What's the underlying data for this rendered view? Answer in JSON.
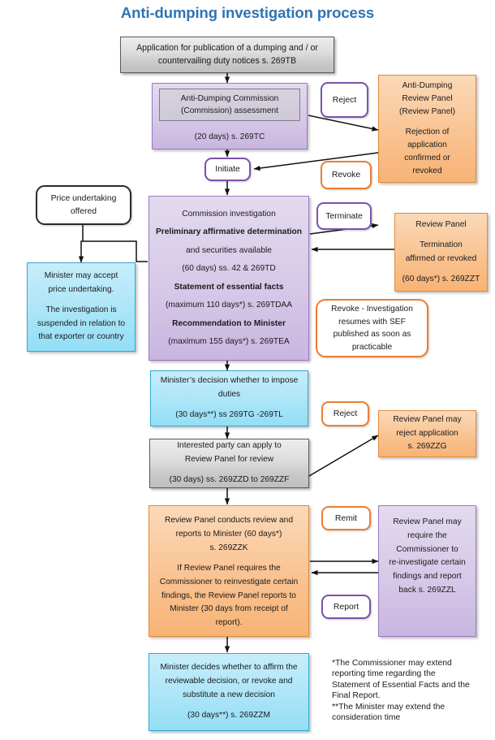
{
  "title": "Anti-dumping investigation process",
  "colors": {
    "title": "#2e74b5",
    "purple_accent": "#7b52ab",
    "orange_accent": "#ed7d31",
    "cyan_fill": "#aee6f8",
    "orange_fill": "#f9c392",
    "purple_fill": "#d6c9e8",
    "grey_fill": "#dcdcdc"
  },
  "nodes": {
    "application": {
      "line1": "Application for publication of a dumping and / or",
      "line2": "countervailing duty notices s. 269TB"
    },
    "commission_assessment": {
      "inner_line1": "Anti-Dumping Commission",
      "inner_line2": "(Commission) assessment",
      "days": "(20 days) s. 269TC"
    },
    "reject_1": {
      "label": "Reject"
    },
    "revoke_1": {
      "label": "Revoke"
    },
    "adrp": {
      "line1": "Anti-Dumping",
      "line2": "Review Panel",
      "line3": "(Review Panel)",
      "line4": "Rejection of",
      "line5": "application",
      "line6": "confirmed or",
      "line7": "revoked"
    },
    "initiate": {
      "label": "Initiate"
    },
    "price_undertaking_offered": {
      "line1": "Price undertaking",
      "line2": "offered"
    },
    "minister_may_accept": {
      "line1": "Minister may accept",
      "line2": "price undertaking.",
      "line3": "The investigation is",
      "line4": "suspended in relation to",
      "line5": "that exporter or country"
    },
    "commission_investigation": {
      "line1": "Commission investigation",
      "line2": "Preliminary affirmative determination",
      "line3": "and securities available",
      "line4": "(60 days) ss. 42 & 269TD",
      "line5": "Statement of essential facts",
      "line6": "(maximum 110 days*) s. 269TDAA",
      "line7": "Recommendation to Minister",
      "line8": "(maximum 155 days*) s. 269TEA"
    },
    "terminate": {
      "label": "Terminate"
    },
    "review_panel_termination": {
      "line1": "Review Panel",
      "line2": "Termination",
      "line3": "affirmed or revoked",
      "line4": "(60 days*) s. 269ZZT"
    },
    "revoke_investigation": {
      "line1": "Revoke - Investigation",
      "line2": "resumes with SEF",
      "line3": "published as soon as",
      "line4": "practicable"
    },
    "minister_decision_duties": {
      "line1": "Minister’s decision whether to impose",
      "line2": "duties",
      "line3": "(30 days**) ss 269TG -269TL"
    },
    "reject_2": {
      "label": "Reject"
    },
    "interested_party": {
      "line1": "Interested party can apply to",
      "line2": "Review Panel for review",
      "line3": "(30 days) ss. 269ZZD to 269ZZF"
    },
    "review_panel_reject": {
      "line1": "Review Panel may",
      "line2": "reject application",
      "line3": "s. 269ZZG"
    },
    "remit": {
      "label": "Remit"
    },
    "report": {
      "label": "Report"
    },
    "review_panel_conducts": {
      "line1": "Review Panel conducts review and",
      "line2": "reports to Minister (60 days*)",
      "line3": "s. 269ZZK",
      "line4": "If Review Panel requires the",
      "line5": "Commissioner to reinvestigate certain",
      "line6": "findings, the Review Panel reports to",
      "line7": "Minister (30 days from receipt of",
      "line8": "report)."
    },
    "review_panel_may_require": {
      "line1": "Review Panel may",
      "line2": "require the",
      "line3": "Commissioner to",
      "line4": "re-investigate certain",
      "line5": "findings and report",
      "line6": "back s. 269ZZL"
    },
    "minister_decides_affirm": {
      "line1": "Minister decides whether to affirm the",
      "line2": "reviewable decision, or revoke and",
      "line3": "substitute a new decision",
      "line4": "(30 days**) s. 269ZZM"
    }
  },
  "footnote": {
    "line1": "*The Commissioner may extend",
    "line2": "reporting time regarding the",
    "line3": "Statement of Essential Facts and the",
    "line4": "Final Report.",
    "line5": "**The Minister may extend the",
    "line6": "consideration time"
  }
}
